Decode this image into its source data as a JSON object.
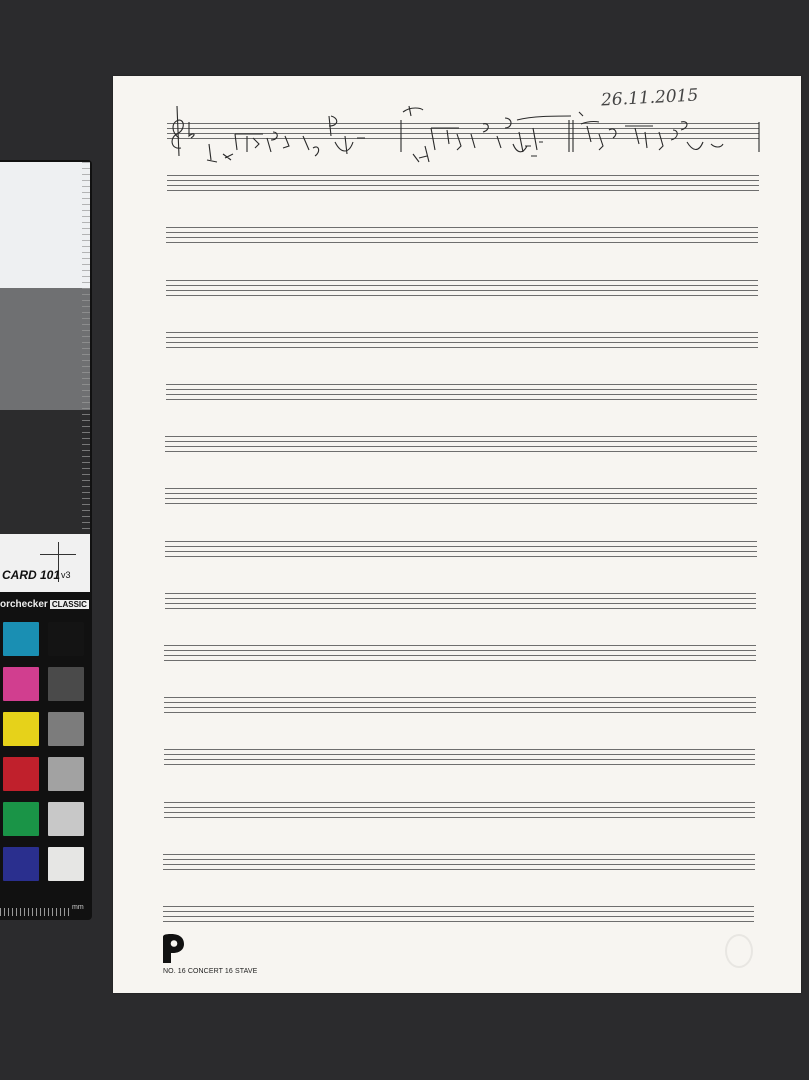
{
  "color_card": {
    "name": "CARD 101",
    "version": "v3",
    "brand": "orchecker",
    "brand_tag": "CLASSIC",
    "ruler_unit": "mm",
    "swatches": [
      {
        "color": "#1a8fb3"
      },
      {
        "color": "#141414"
      },
      {
        "color": "#d13e8f"
      },
      {
        "color": "#4a4a4a"
      },
      {
        "color": "#e6d21a"
      },
      {
        "color": "#7c7c7c"
      },
      {
        "color": "#c0202c"
      },
      {
        "color": "#a2a2a2"
      },
      {
        "color": "#1a9447"
      },
      {
        "color": "#c8c8c8"
      },
      {
        "color": "#2a2f8e"
      },
      {
        "color": "#e6e6e4"
      }
    ]
  },
  "manuscript": {
    "handwritten_date": "26.11.2015",
    "stave_count": 16,
    "footer_label": "NO. 16 CONCERT 16 STAVE",
    "publisher_logo": "P"
  }
}
